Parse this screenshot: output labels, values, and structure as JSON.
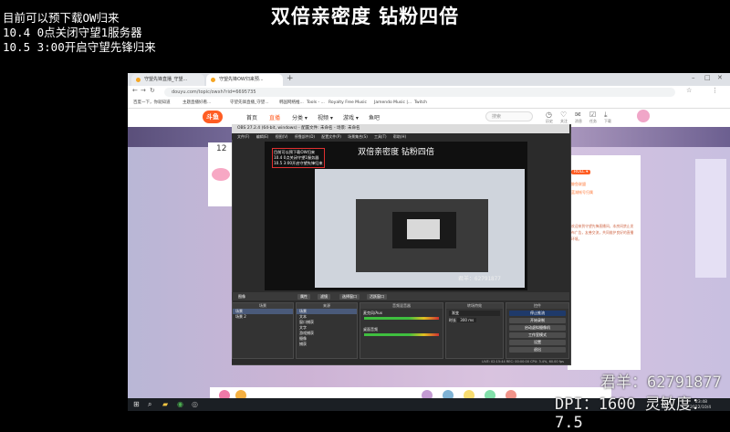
{
  "overlay": {
    "title": "双倍亲密度 钻粉四倍",
    "notes": [
      "目前可以预下载OW归来",
      "10.4 0点关闭守望1服务器",
      "10.5 3:00开启守望先锋归来"
    ],
    "sheep_label": "君羊：62791877",
    "dpi_label": "DPI：1600 灵敏度：7.5"
  },
  "browser": {
    "tabs": [
      "守望先锋直播_守望...",
      "守望先锋OW归来预..."
    ],
    "add_tab": "+",
    "url": "douyu.com/topic/owxh?rid=6695735",
    "bookmarks": [
      "百度一下，你就知道",
      "主题直播好看...",
      "守望先锋直播_守望...",
      "韩国网络推...",
      "Tools - ...",
      "Royalty Free Music",
      "Jamendo Music |...",
      "Twitch"
    ],
    "window_controls": [
      "–",
      "□",
      "✕"
    ]
  },
  "douyu": {
    "logo": "斗鱼",
    "nav": [
      "首页",
      "直播",
      "分类 ▾",
      "视频 ▾",
      "游戏 ▾",
      "鱼吧"
    ],
    "search_placeholder": "搜索",
    "header_icons": [
      {
        "icon": "history-icon",
        "label": "历史"
      },
      {
        "icon": "follow-icon",
        "label": "关注"
      },
      {
        "icon": "message-icon",
        "label": "消息"
      },
      {
        "icon": "task-icon",
        "label": "任务"
      },
      {
        "icon": "download-icon",
        "label": "下载"
      }
    ],
    "room_number": "12",
    "chat": {
      "badge": "ROLL ▾",
      "header_lines": [
        "鲸鱼联盟",
        "蓝湖帐号归属"
      ],
      "message": "欢迎来到守望先锋直播间，本房间禁止发布广告，友善交流，共同维护良好的直播环境。"
    }
  },
  "obs": {
    "title": "OBS 27.2.4 (64-bit, windows) - 配置文件: 未命名 - 场景: 未命名",
    "menu": [
      "文件(F)",
      "编辑(E)",
      "视图(V)",
      "停靠部件(D)",
      "配置文件(P)",
      "场景集合(S)",
      "工具(T)",
      "帮助(H)"
    ],
    "preview": {
      "title": "双倍亲密度 钻粉四倍",
      "notes": [
        "目前可以预下载OW归来",
        "10.4 0点关闭守望1服务器",
        "10.5 3:00开启守望先锋归来"
      ],
      "badge": "君羊：62791877"
    },
    "controls_bar": [
      "属性",
      "滤镜",
      "图像",
      "选择窗口",
      "活跃窗口"
    ],
    "docks": {
      "scenes": {
        "title": "场景",
        "items": [
          "场景",
          "场景 2"
        ]
      },
      "sources": {
        "title": "来源",
        "items": [
          "场景",
          "文本",
          "窗口捕获",
          "文字",
          "游戏捕获",
          "摄像",
          "捕获"
        ]
      },
      "mixer": {
        "title": "音频混音器",
        "channels": [
          "麦克风/Aux",
          "桌面音频"
        ]
      },
      "transition": {
        "title": "转场特效",
        "type": "渐变",
        "duration_label": "时长",
        "duration": "300 ms"
      },
      "controls": {
        "title": "控件",
        "buttons": [
          "停止推流",
          "开始录制",
          "启动虚拟摄像机",
          "工作室模式",
          "设置",
          "退出"
        ]
      }
    },
    "status": "LIVE: 02:15:44   REC: 00:00:00   CPU: 3.4%, 60.00 fps"
  },
  "taskbar": {
    "start": "⊞",
    "clock": "23:48",
    "date": "2022/10/4"
  }
}
